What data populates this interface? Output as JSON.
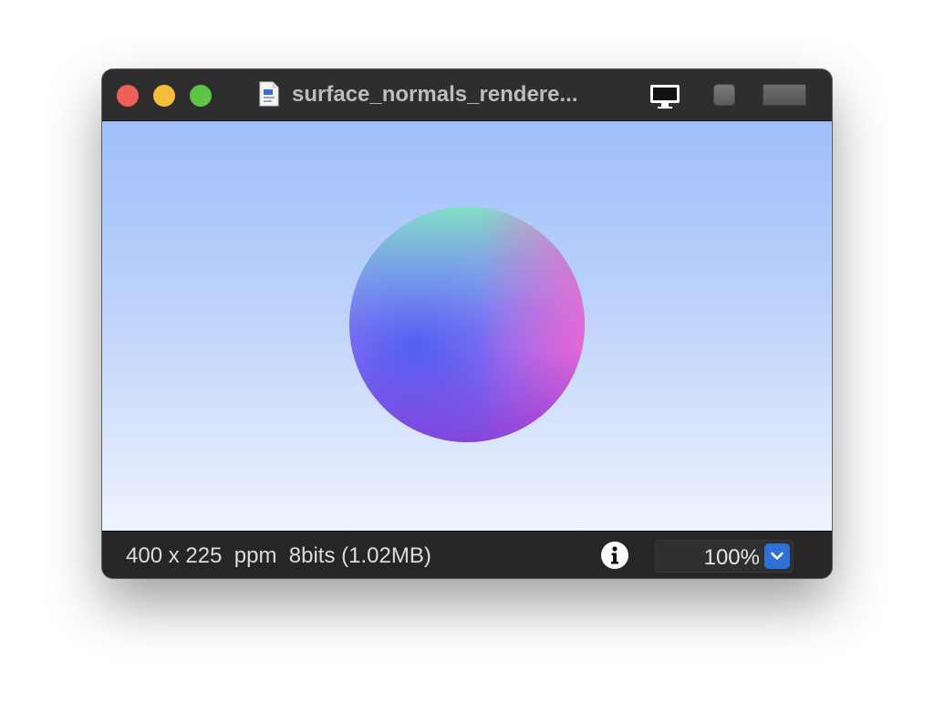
{
  "window": {
    "title": "surface_normals_rendere...",
    "title_icon": "document-icon"
  },
  "toolbar": {
    "monitor_icon": "monitor-icon",
    "square_button": "square-button",
    "wide_button": "wide-button"
  },
  "image": {
    "description_colors": {
      "sky_top": "#9fbffa",
      "sky_bottom": "#eef3fe"
    }
  },
  "statusbar": {
    "info_text": "400 x 225  ppm  8bits (1.02MB)",
    "info_icon": "info-icon",
    "zoom_value": "100%",
    "zoom_icon": "chevron-down-icon"
  },
  "colors": {
    "close": "#ee5f57",
    "minimize": "#f6bd3b",
    "zoom": "#5ec547",
    "accent": "#2f6fd6"
  }
}
